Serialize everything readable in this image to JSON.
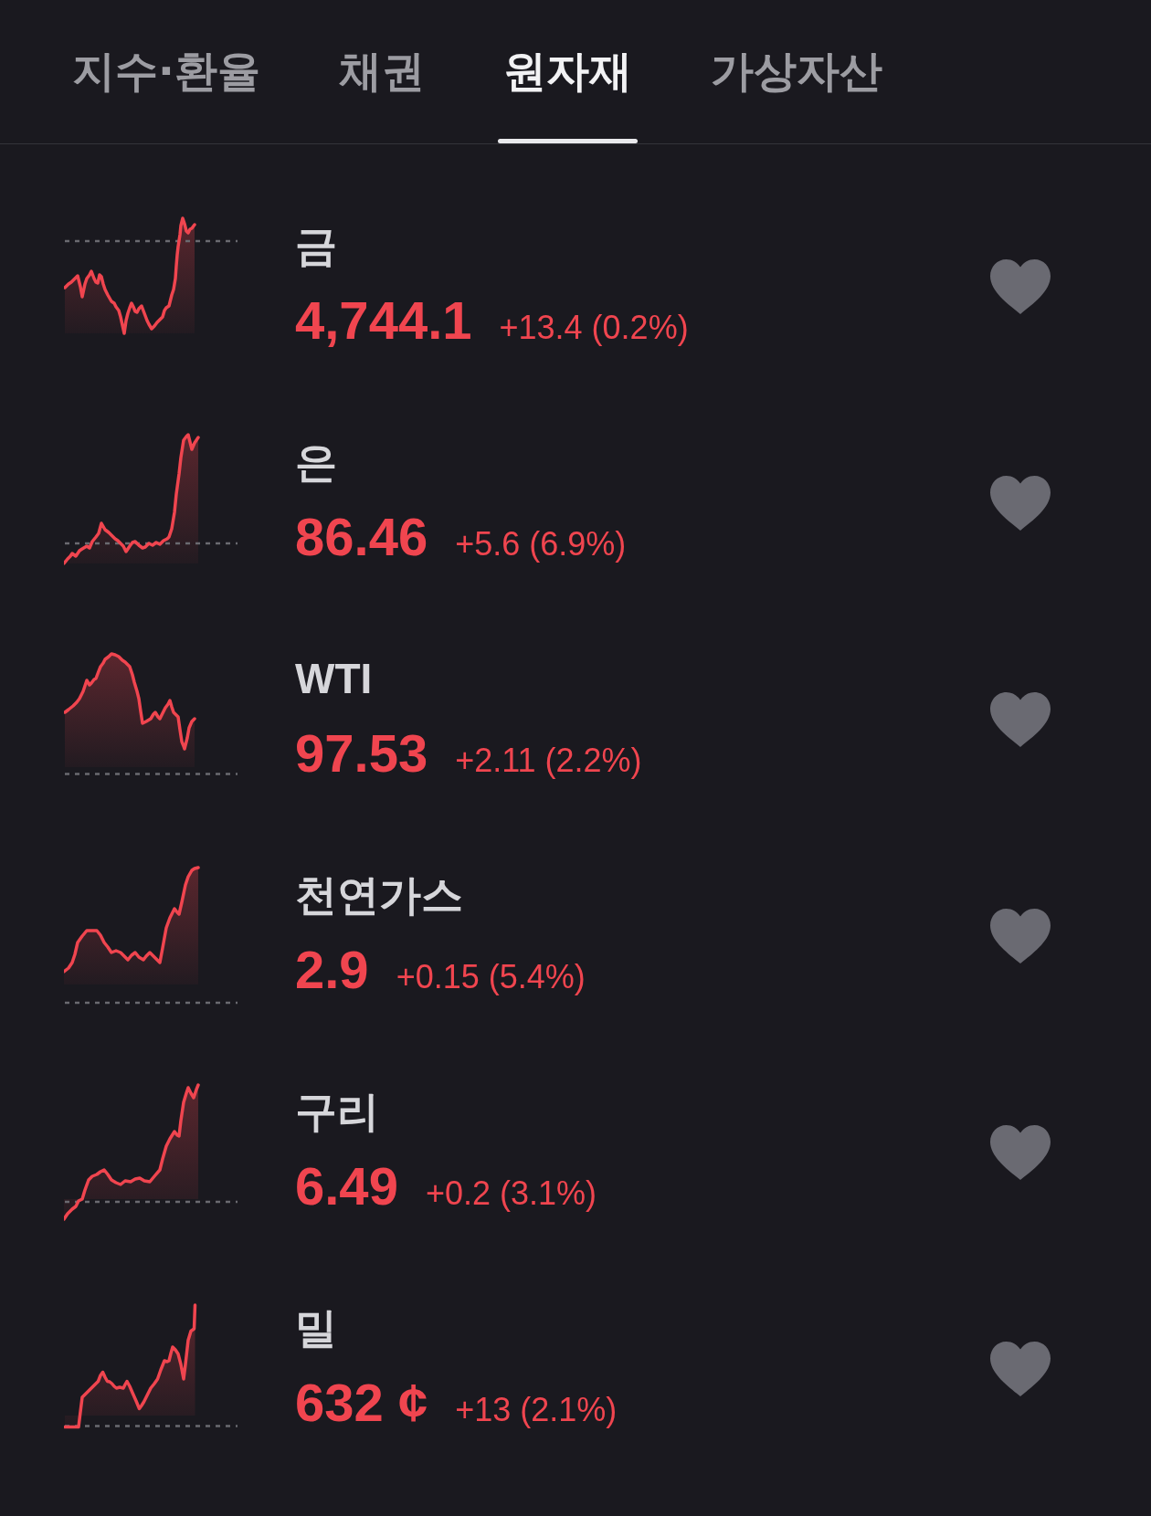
{
  "tabs": [
    {
      "label": "지수·환율",
      "selected": false
    },
    {
      "label": "채권",
      "selected": false
    },
    {
      "label": "원자재",
      "selected": true
    },
    {
      "label": "가상자산",
      "selected": false
    }
  ],
  "items": [
    {
      "name": "금",
      "price": "4,744.1",
      "change": "+13.4 (0.2%)",
      "rising": true,
      "favorited": false
    },
    {
      "name": "은",
      "price": "86.46",
      "change": "+5.6 (6.9%)",
      "rising": true,
      "favorited": false
    },
    {
      "name": "WTI",
      "price": "97.53",
      "change": "+2.11 (2.2%)",
      "rising": true,
      "favorited": false
    },
    {
      "name": "천연가스",
      "price": "2.9",
      "change": "+0.15 (5.4%)",
      "rising": true,
      "favorited": false
    },
    {
      "name": "구리",
      "price": "6.49",
      "change": "+0.2 (3.1%)",
      "rising": true,
      "favorited": false
    },
    {
      "name": "밀",
      "price": "632 ¢",
      "change": "+13 (2.1%)",
      "rising": true,
      "favorited": false
    }
  ]
}
